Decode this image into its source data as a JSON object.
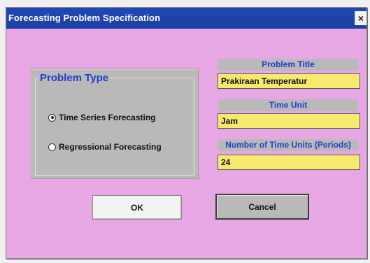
{
  "window": {
    "title": "Forecasting Problem Specification",
    "close_glyph": "×"
  },
  "problem_type": {
    "legend": "Problem Type",
    "options": [
      {
        "label": "Time Series Forecasting",
        "checked": true
      },
      {
        "label": "Regressional Forecasting",
        "checked": false
      }
    ]
  },
  "fields": {
    "problem_title": {
      "label": "Problem Title",
      "value": "Prakiraan Temperatur"
    },
    "time_unit": {
      "label": "Time Unit",
      "value": "Jam"
    },
    "num_periods": {
      "label": "Number of Time Units (Periods)",
      "value": "24"
    }
  },
  "buttons": {
    "ok": "OK",
    "cancel": "Cancel"
  },
  "colors": {
    "titlebar": "#1f49b4",
    "window_bg": "#e7a6e4",
    "panel": "#b9b9b9",
    "label_text": "#1e3fcb",
    "input_bg": "#f6ea6e"
  }
}
